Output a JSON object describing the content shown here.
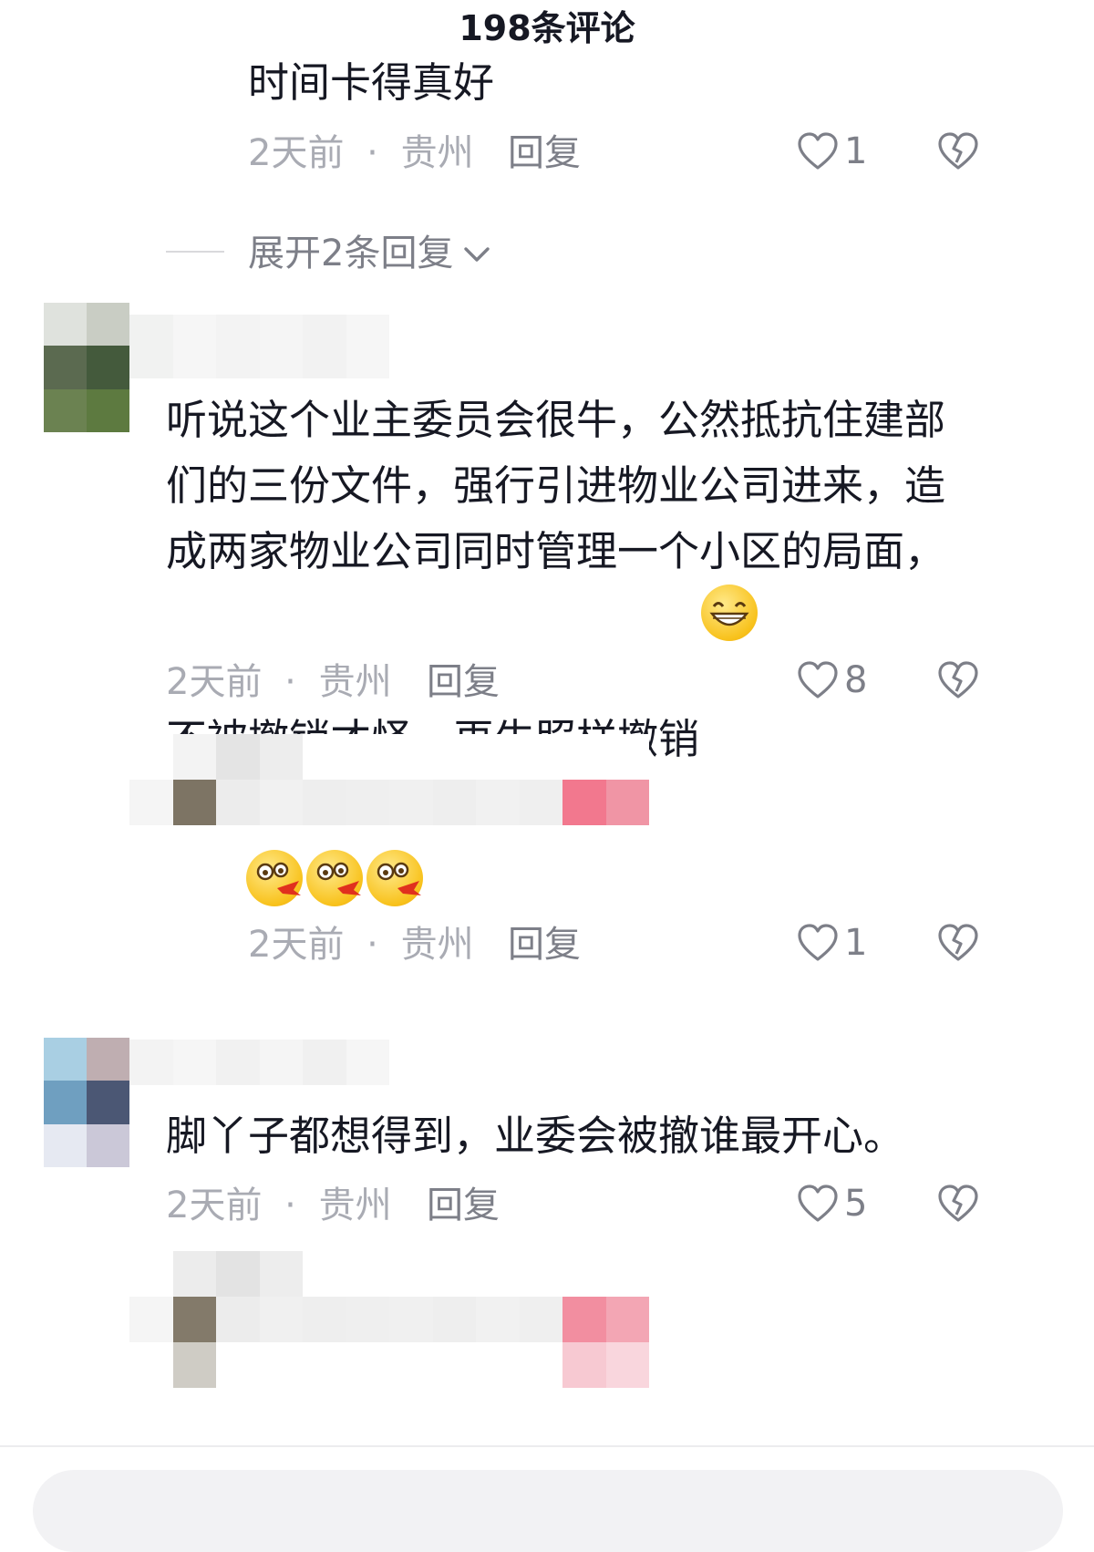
{
  "header": {
    "title": "198条评论"
  },
  "comments": [
    {
      "text": "时间卡得真好",
      "time": "2天前",
      "location": "贵州",
      "reply_label": "回复",
      "likes": "1",
      "expand_replies": "展开2条回复"
    },
    {
      "text": "听说这个业主委员会很牛，公然抵抗住建部们的三份文件，强行引进物业公司进来，造成两家物业公司同时管理一个小区的局面，不被撤销才怪，再牛照样撤销",
      "time": "2天前",
      "location": "贵州",
      "reply_label": "回复",
      "likes": "8",
      "emoji": "grin-emoji"
    },
    {
      "text": "",
      "time": "2天前",
      "location": "贵州",
      "reply_label": "回复",
      "likes": "1",
      "emoji": "shocked-spitting-emoji ×3"
    },
    {
      "text": "脚丫子都想得到，业委会被撤谁最开心。",
      "time": "2天前",
      "location": "贵州",
      "reply_label": "回复",
      "likes": "5"
    }
  ],
  "separator": "·",
  "icons": {
    "like": "heart-outline-icon",
    "dislike": "broken-heart-icon",
    "expand": "chevron-down-icon"
  },
  "colors": {
    "text": "#161823",
    "meta": "#a9abb3",
    "action": "#7d7f88"
  }
}
